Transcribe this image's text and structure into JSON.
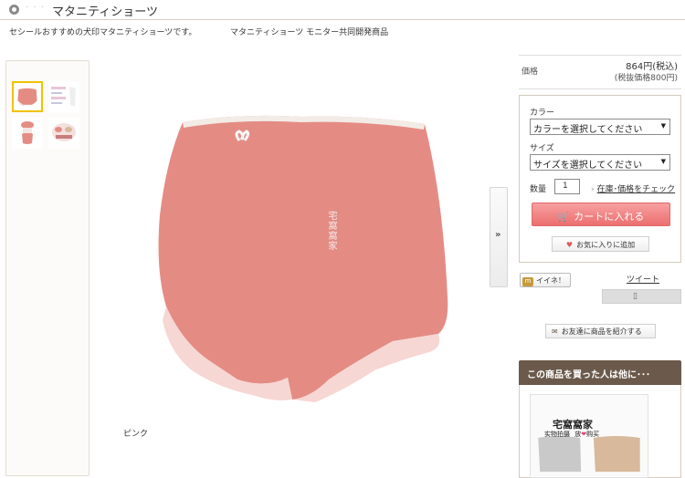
{
  "header": {
    "title": "マタニティショーツ",
    "subtitle_left": "セシールおすすめの犬印マタニティショーツです。",
    "subtitle_right": "マタニティショーツ モニター共同開発商品"
  },
  "gallery": {
    "caption": "ピンク",
    "watermark": "宅窩窩家",
    "thumbnails": 4,
    "selected_thumbnail": 1,
    "product_color": "#e48c84",
    "lace_color": "#f6d7d3",
    "next_arrow": "»"
  },
  "price": {
    "label": "価格",
    "value": "864円(税込)",
    "note": "(税抜価格800円)"
  },
  "purchase": {
    "color_label": "カラー",
    "color_select": "カラーを選択してください",
    "size_label": "サイズ",
    "size_select": "サイズを選択してください",
    "qty_label": "数量",
    "qty_value": "1",
    "stock_link": "在庫･価格をチェック",
    "cart_button": "カートに入れる",
    "favorite_button": "お気に入りに追加",
    "cart_color": "#ec6f6f"
  },
  "social": {
    "like_icon_text": "m",
    "like_button": "イイネ！",
    "tweet": "ツイート",
    "share_icon_glyph": "▯",
    "intro_button": "お友達に商品を紹介する"
  },
  "also_bought": {
    "title": "この商品を買った人は他に･･･",
    "watermark_title": "宅窩窩家",
    "watermark_sub_1": "实物拍摄",
    "watermark_sub_2": "放",
    "watermark_heart": "❤",
    "watermark_sub_3": "购买",
    "header_color": "#6b5a4b"
  }
}
